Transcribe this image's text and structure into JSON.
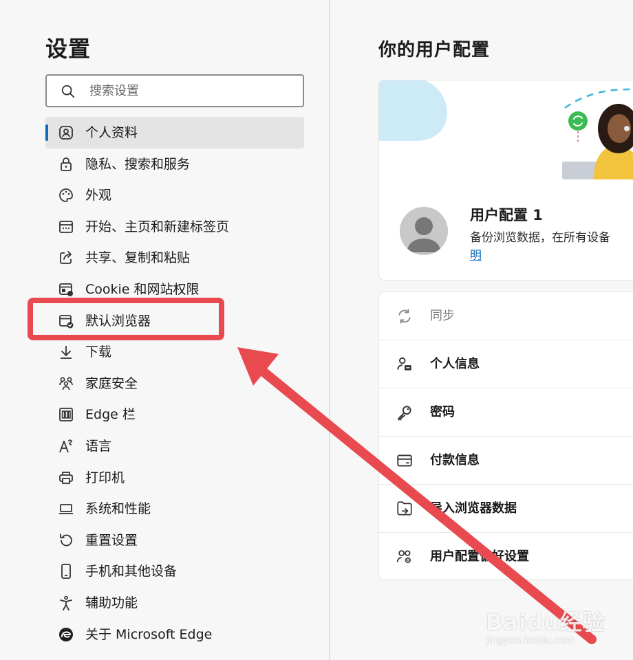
{
  "sidebar": {
    "title": "设置",
    "search": {
      "placeholder": "搜索设置",
      "value": ""
    },
    "items": [
      {
        "label": "个人资料",
        "icon": "profile-icon",
        "active": true
      },
      {
        "label": "隐私、搜索和服务",
        "icon": "lock-icon"
      },
      {
        "label": "外观",
        "icon": "palette-icon"
      },
      {
        "label": "开始、主页和新建标签页",
        "icon": "start-page-icon"
      },
      {
        "label": "共享、复制和粘贴",
        "icon": "share-icon"
      },
      {
        "label": "Cookie 和网站权限",
        "icon": "site-permissions-icon"
      },
      {
        "label": "默认浏览器",
        "icon": "default-browser-icon"
      },
      {
        "label": "下载",
        "icon": "download-icon"
      },
      {
        "label": "家庭安全",
        "icon": "family-icon"
      },
      {
        "label": "Edge 栏",
        "icon": "edge-bar-icon"
      },
      {
        "label": "语言",
        "icon": "language-icon"
      },
      {
        "label": "打印机",
        "icon": "printer-icon"
      },
      {
        "label": "系统和性能",
        "icon": "laptop-icon"
      },
      {
        "label": "重置设置",
        "icon": "reset-icon"
      },
      {
        "label": "手机和其他设备",
        "icon": "phone-icon"
      },
      {
        "label": "辅助功能",
        "icon": "accessibility-icon"
      },
      {
        "label": "关于 Microsoft Edge",
        "icon": "edge-logo-icon"
      }
    ]
  },
  "main": {
    "title": "你的用户配置",
    "profile": {
      "name": "用户配置 1",
      "description": "备份浏览数据，在所有设备",
      "link": "明"
    },
    "menu": [
      {
        "label": "同步",
        "icon": "sync-icon",
        "muted": true
      },
      {
        "label": "个人信息",
        "icon": "personal-info-icon"
      },
      {
        "label": "密码",
        "icon": "key-icon"
      },
      {
        "label": "付款信息",
        "icon": "card-icon"
      },
      {
        "label": "导入浏览器数据",
        "icon": "import-icon"
      },
      {
        "label": "用户配置偏好设置",
        "icon": "profile-preferences-icon"
      }
    ]
  },
  "colors": {
    "accent": "#0f6cbd",
    "annotation": "#e84a4f",
    "sidebar_active": "#e4e4e4",
    "background": "#f7f7f7"
  },
  "watermark": {
    "brand": "Baidu经验",
    "url": "jingyan.baidu.com"
  }
}
